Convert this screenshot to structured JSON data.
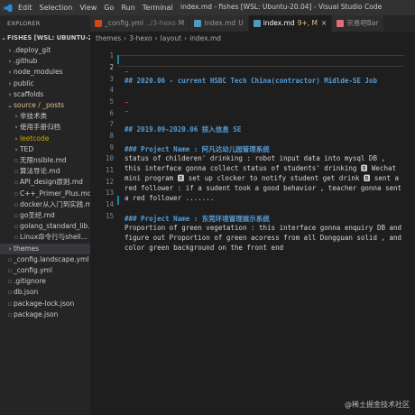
{
  "menu": [
    "Edit",
    "Selection",
    "View",
    "Go",
    "Run",
    "Terminal"
  ],
  "window_title": "index.md - fishes [WSL: Ubuntu-20.04] - Visual Studio Code",
  "explorer": {
    "title": "EXPLORER",
    "root": "FISHES [WSL: UBUNTU-20.04]",
    "items": [
      {
        "label": ".deploy_git",
        "chev": "›",
        "indent": 1,
        "cls": ""
      },
      {
        "label": ".github",
        "chev": "›",
        "indent": 1,
        "cls": ""
      },
      {
        "label": "node_modules",
        "chev": "›",
        "indent": 1,
        "cls": ""
      },
      {
        "label": "public",
        "chev": "›",
        "indent": 1,
        "cls": ""
      },
      {
        "label": "scaffolds",
        "chev": "›",
        "indent": 1,
        "cls": ""
      },
      {
        "label": "source / _posts",
        "chev": "⌄",
        "indent": 1,
        "cls": "git"
      },
      {
        "label": "非技术类",
        "chev": "›",
        "indent": 2,
        "cls": ""
      },
      {
        "label": "使用手册归档",
        "chev": "›",
        "indent": 2,
        "cls": ""
      },
      {
        "label": "leetcode",
        "chev": "›",
        "indent": 2,
        "cls": "yel"
      },
      {
        "label": "TED",
        "chev": "›",
        "indent": 2,
        "cls": ""
      },
      {
        "label": "无限nsible.md",
        "chev": "",
        "indent": 2,
        "cls": ""
      },
      {
        "label": "算法导论.md",
        "chev": "",
        "indent": 2,
        "cls": ""
      },
      {
        "label": "API_design原则.md",
        "chev": "",
        "indent": 2,
        "cls": ""
      },
      {
        "label": "C++_Primer_Plus.md",
        "chev": "",
        "indent": 2,
        "cls": ""
      },
      {
        "label": "docker从入门到实践.md",
        "chev": "",
        "indent": 2,
        "cls": ""
      },
      {
        "label": "go圣经.md",
        "chev": "",
        "indent": 2,
        "cls": ""
      },
      {
        "label": "golang_standard_lib...",
        "chev": "",
        "indent": 2,
        "cls": ""
      },
      {
        "label": "Linux命令行与shell...",
        "chev": "",
        "indent": 2,
        "cls": ""
      },
      {
        "label": "themes",
        "chev": "›",
        "indent": 1,
        "cls": "sel"
      },
      {
        "label": "_config.landscape.yml",
        "chev": "",
        "indent": 1,
        "cls": ""
      },
      {
        "label": "_config.yml",
        "chev": "",
        "indent": 1,
        "cls": ""
      },
      {
        "label": ".gitignore",
        "chev": "",
        "indent": 1,
        "cls": ""
      },
      {
        "label": "db.json",
        "chev": "",
        "indent": 1,
        "cls": ""
      },
      {
        "label": "package-lock.json",
        "chev": "",
        "indent": 1,
        "cls": ""
      },
      {
        "label": "package.json",
        "chev": "",
        "indent": 1,
        "cls": ""
      }
    ]
  },
  "tabs": [
    {
      "label": "_config.yml",
      "desc": "../3-hexo",
      "mod": "M",
      "active": false,
      "color": "#cb4b16"
    },
    {
      "label": "index.md",
      "desc": "",
      "mod": "U",
      "active": false,
      "color": "#519aba"
    },
    {
      "label": "index.md",
      "desc": "",
      "mod": "9+, M",
      "active": true,
      "color": "#519aba"
    },
    {
      "label": "宗易吧Bar",
      "desc": "",
      "mod": "",
      "active": false,
      "color": "#e06c75"
    }
  ],
  "breadcrumb": [
    "themes",
    "3-hexo",
    "layout",
    "index.md"
  ],
  "editor": {
    "line_numbers": [
      "1",
      "2",
      "3",
      "4",
      "5",
      "6",
      "7",
      "8",
      "9",
      "10",
      "11",
      "12",
      "13",
      "14",
      "15"
    ],
    "lines": [
      {
        "t": "",
        "c": ""
      },
      {
        "t": "",
        "c": ""
      },
      {
        "t": "~",
        "c": ""
      },
      {
        "t": "## 2020.06 - current HSBC Tech China(contractor) Midlde-SE Job",
        "c": "hd"
      },
      {
        "t": "",
        "c": ""
      },
      {
        "t": "~",
        "c": ""
      },
      {
        "t": "~",
        "c": ""
      },
      {
        "t": "## 2019.09-2020.06 掠入信息 SE",
        "c": "hd"
      },
      {
        "t": "",
        "c": ""
      },
      {
        "t": "### Project Name : 阿凡达幼儿园管理系统",
        "c": "hd"
      },
      {
        "t": "status of childeren' drinking : robot input data into mysql DB ,",
        "c": ""
      },
      {
        "t": "this interface gonna collect status of students' drinking 🅱 Wechat",
        "c": ""
      },
      {
        "t": "mini program 🅱 set up clocker to notify student get drink 🅱 sent a",
        "c": ""
      },
      {
        "t": "red follower : if a sudent took a good behavior , teacher gonna sent",
        "c": ""
      },
      {
        "t": "a red follower .......",
        "c": ""
      },
      {
        "t": "",
        "c": ""
      },
      {
        "t": "### Project Name : 东莞环境管理展示系统",
        "c": "hd"
      },
      {
        "t": "Proportion of green vegetation : this interface gonna enquiry DB and",
        "c": ""
      },
      {
        "t": "figure out Proportion of green acoress from all Dongguan solid , and",
        "c": ""
      },
      {
        "t": "color green background on the front end",
        "c": ""
      }
    ]
  },
  "watermark": "@稀土掘金技术社区"
}
